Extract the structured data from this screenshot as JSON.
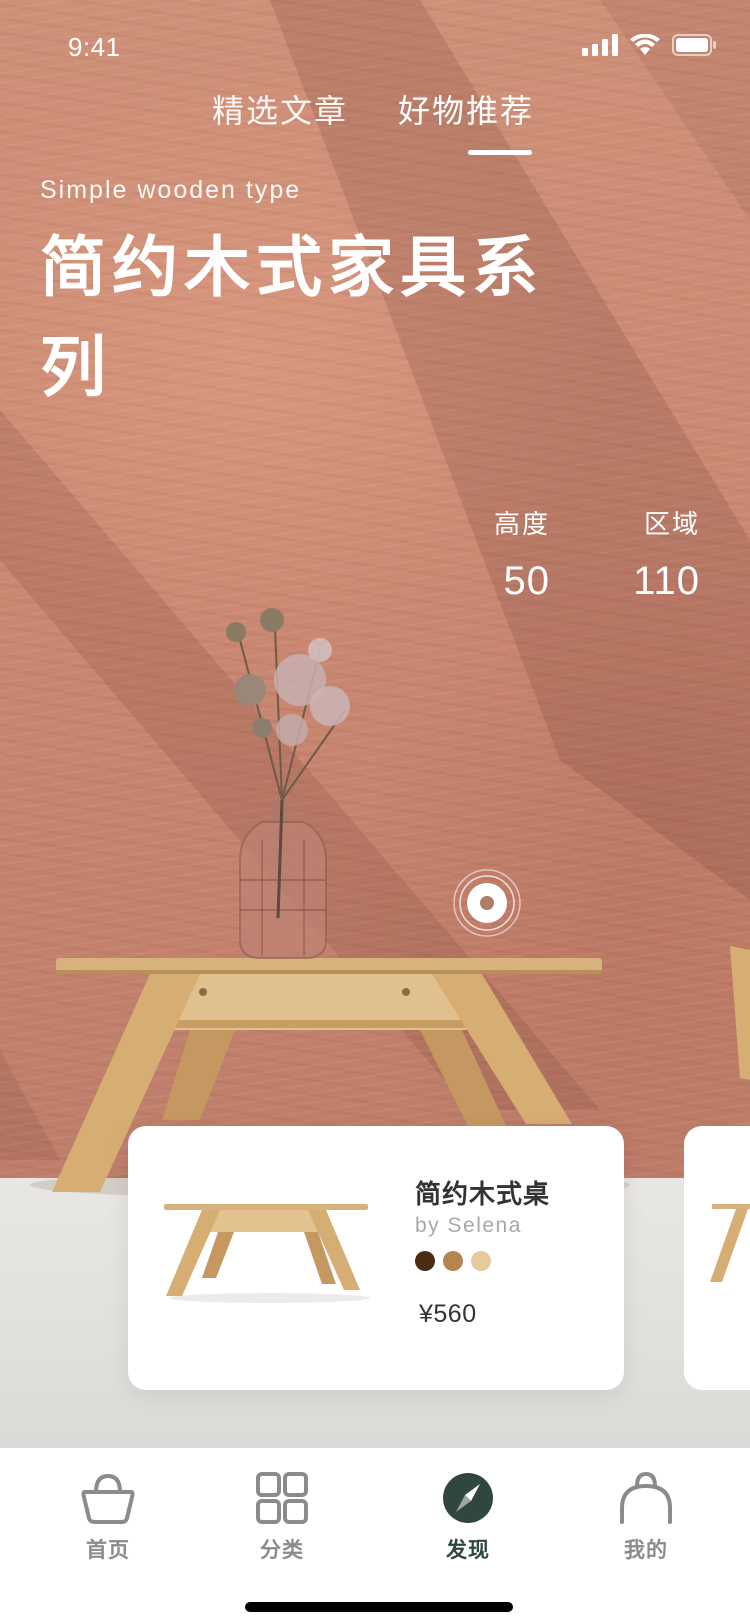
{
  "status_bar": {
    "time": "9:41",
    "icons": [
      "signal-icon",
      "wifi-icon",
      "battery-icon"
    ]
  },
  "tabs": [
    {
      "label": "精选文章",
      "active": false
    },
    {
      "label": "好物推荐",
      "active": true
    }
  ],
  "hero": {
    "subtitle": "Simple wooden type",
    "title": "简约木式家具系列"
  },
  "stats": {
    "height": {
      "label": "高度",
      "value": "50"
    },
    "area": {
      "label": "区域",
      "value": "110"
    }
  },
  "product_card": {
    "name": "简约木式桌",
    "author": "by Selena",
    "price": "¥560",
    "swatches": [
      "#4a2b14",
      "#b5854f",
      "#e8c99a"
    ]
  },
  "bottom_nav": {
    "items": [
      {
        "label": "首页",
        "icon": "shopping-basket-icon",
        "active": false
      },
      {
        "label": "分类",
        "icon": "grid-icon",
        "active": false
      },
      {
        "label": "发现",
        "icon": "compass-icon",
        "active": true
      },
      {
        "label": "我的",
        "icon": "user-bag-icon",
        "active": false
      }
    ]
  },
  "colors": {
    "wall": "#c98670",
    "floor": "#e6e4e1",
    "accent": "#2f4740",
    "nav_inactive": "#8b8b8b",
    "text_dark": "#333333"
  }
}
